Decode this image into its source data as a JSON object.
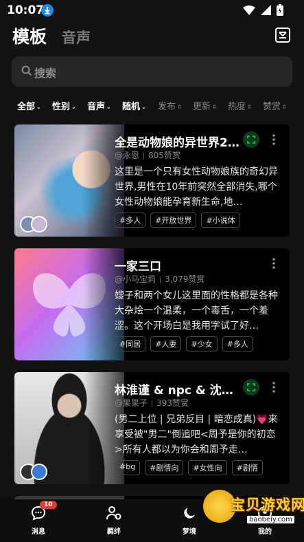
{
  "status": {
    "time": "10:07"
  },
  "header": {
    "tab_active": "模板",
    "tab_inactive": "音声"
  },
  "search": {
    "placeholder": "搜索"
  },
  "filters": [
    {
      "label": "全部",
      "active": true
    },
    {
      "label": "性别",
      "active": true
    },
    {
      "label": "音声",
      "active": true
    },
    {
      "label": "随机",
      "active": true
    },
    {
      "label": "发布",
      "active": false
    },
    {
      "label": "更新",
      "active": false
    },
    {
      "label": "热度",
      "active": false
    },
    {
      "label": "赞赏",
      "active": false
    }
  ],
  "cards": [
    {
      "title": "全是动物娘的异世界2.0版",
      "author": "@永恩",
      "likes": "805赞赏",
      "desc": "这里是一个只有女性动物娘族的奇幻异世界,男性在10年前突然全部消失,哪个女性动物娘能孕育新生命,地…",
      "tags": [
        "#多人",
        "#开放世界",
        "#小说体"
      ]
    },
    {
      "title": "一家三口",
      "author": "@小马宝莉",
      "likes": "3,079赞赏",
      "desc": "嫂子和两个女儿这里面的性格都是各种大杂烩一个温柔，一个毒舌，一个羞涩。这个开场白是我用字试了好…",
      "tags": [
        "#同居",
        "#人妻",
        "#少女",
        "#多人"
      ]
    },
    {
      "title": "林淮谨 & npc & 沈念之…",
      "author": "@果果子",
      "likes": "393赞赏",
      "desc": "(男二上位 | 兄弟反目 | 暗恋成真)💗来享受被\"男二\"倒追吧<周予是你的初恋>所有人都以为你会和周予走…",
      "tags": [
        "#bg",
        "#剧情向",
        "#女性向",
        "#剧情"
      ]
    }
  ],
  "bottom_nav": [
    {
      "label": "消息",
      "icon": "chat-icon",
      "count": "10"
    },
    {
      "label": "羁绊",
      "icon": "friends-icon"
    },
    {
      "label": "梦境",
      "icon": "moon-icon"
    },
    {
      "label": "我的",
      "icon": "profile-icon"
    }
  ],
  "watermark": {
    "title": "宝贝游戏网",
    "url": "baobeiy.com"
  },
  "colors": {
    "background": "#121212",
    "card": "#000000",
    "badge_red": "#e53935",
    "accent_green": "#1db954"
  }
}
